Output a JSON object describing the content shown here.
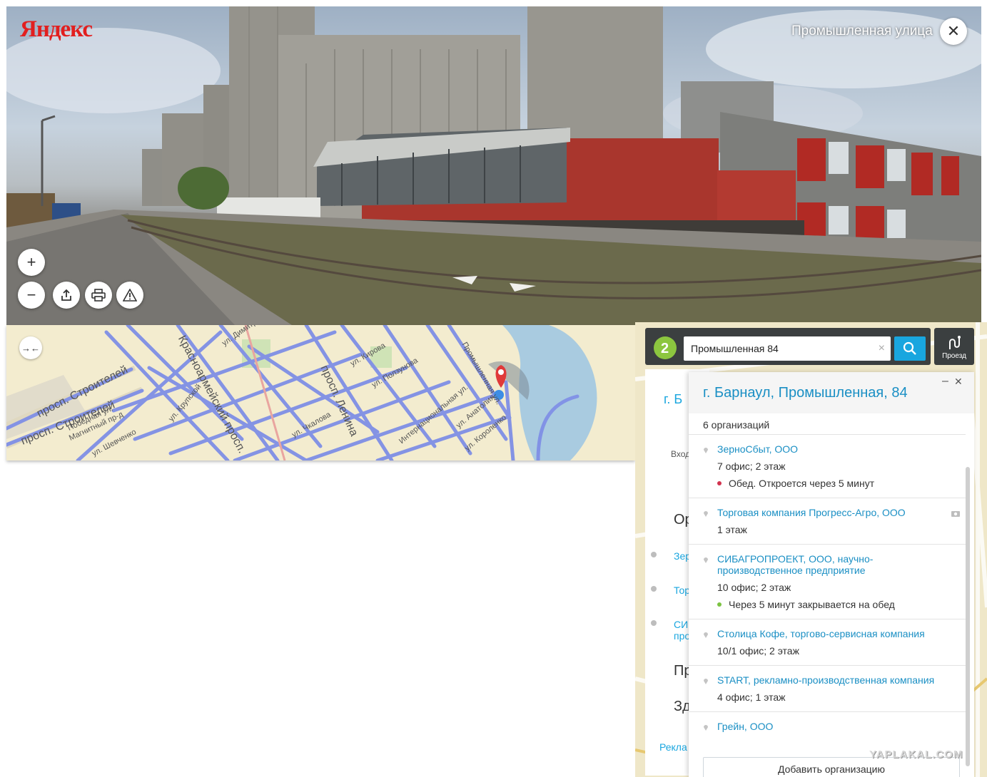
{
  "panorama": {
    "brand": "Яндекс",
    "street_name": "Промышленная улица",
    "controls": {
      "close": "✕",
      "zoom_in": "+",
      "zoom_out": "−"
    }
  },
  "map": {
    "collapse_icon": "→←",
    "labels": {
      "prosp_stroiteley_1": "просп. Строителей",
      "prosp_stroiteley_2": "просп. Строителей",
      "krasnoarm": "Красноармейский просп.",
      "lenina": "просп. Ленина",
      "pobednaya": "Победная ул.",
      "magnitny": "Магнитный пр-д",
      "shevchenko": "ул. Шевченко",
      "kirova": "ул. Кирова",
      "chkalova": "ул. Чкалова",
      "polzunova": "ул. Ползунова",
      "promyshlennaya": "Промышленная ул.",
      "korolenko": "ул. Короленко",
      "internatsionalnaya": "Интернациональная ул.",
      "anatoliya": "ул. Анатолия",
      "kruzhnaya": "ул. Крупской",
      "dimitrova": "ул. Димитрова"
    }
  },
  "gis": {
    "search": {
      "value": "Промышленная 84",
      "clear": "×"
    },
    "route_label": "Проезд",
    "underlay": {
      "a": "г. Б",
      "b": "Вход",
      "c": "Ор",
      "d": "Зер",
      "e": "Тор",
      "f": "СИ",
      "g": "про",
      "h": "Пр",
      "i": "Зд",
      "j": "Рекла"
    },
    "card": {
      "title": "г. Барнаул, Промышленная, 84",
      "minimize": "–",
      "close": "✕",
      "count": "6 организаций",
      "add_button": "Добавить организацию",
      "orgs": [
        {
          "name": "ЗерноСбыт, ООО",
          "address": "7 офис; 2 этаж",
          "status": "Обед. Откроется через 5 минут",
          "status_color": "#d2334f"
        },
        {
          "name": "Торговая компания Прогресс-Агро, ООО",
          "address": "1 этаж"
        },
        {
          "name": "СИБАГРОПРОЕКТ, ООО, научно-производственное предприятие",
          "address": "10 офис; 2 этаж",
          "status": "Через 5 минут закрывается на обед",
          "status_color": "#7cc342"
        },
        {
          "name": "Столица Кофе, торгово-сервисная компания",
          "address": "10/1 офис; 2 этаж"
        },
        {
          "name": "START, рекламно-производственная компания",
          "address": "4 офис; 1 этаж"
        },
        {
          "name": "Грейн, ООО"
        }
      ]
    }
  },
  "watermark": "YAPLAKAL.COM"
}
